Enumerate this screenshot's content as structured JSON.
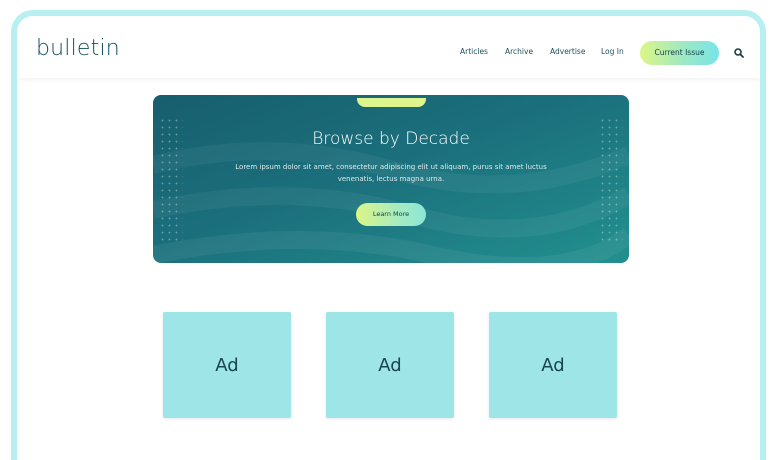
{
  "header": {
    "logo": "bulletin",
    "nav": [
      "Articles",
      "Archive",
      "Advertise",
      "Log In"
    ],
    "cta_label": "Current Issue",
    "search_icon": "search-icon"
  },
  "hero": {
    "title": "Browse by Decade",
    "body": "Lorem ipsum dolor sit amet, consectetur adipiscing elit ut aliquam, purus sit amet luctus venenatis, lectus magna urna.",
    "button_label": "Learn More"
  },
  "ads": [
    "Ad",
    "Ad",
    "Ad"
  ],
  "colors": {
    "frame": "#b8f0f2",
    "brand_text": "#124e5a",
    "hero_dark": "#175e6e",
    "hero_light": "#22908e",
    "accent_lime": "#dcf686",
    "accent_aqua": "#78e4e8",
    "ad_bg": "#9de5e7"
  }
}
